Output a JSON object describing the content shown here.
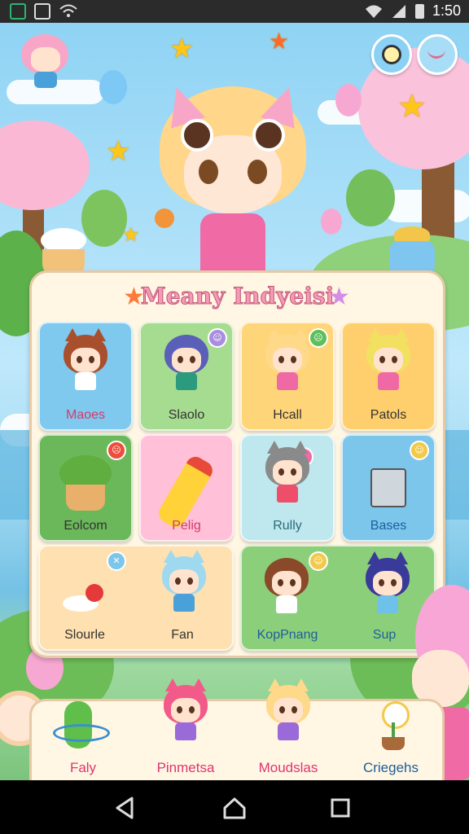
{
  "status_bar": {
    "time": "1:50"
  },
  "panel": {
    "title": "Meany Indyeisi",
    "cards": [
      {
        "label": "Maoes"
      },
      {
        "label": "Slaolo"
      },
      {
        "label": "Hcall"
      },
      {
        "label": "Patols"
      },
      {
        "label": "Eolcom"
      },
      {
        "label": "Pelig"
      },
      {
        "label": "Rully"
      },
      {
        "label": "Bases"
      },
      {
        "label": "Slourle",
        "label2": "Fan"
      },
      {
        "label": "KopPnang",
        "label2": "Sup"
      }
    ]
  },
  "dock": {
    "items": [
      {
        "label": "Faly"
      },
      {
        "label": "Pinmetsa"
      },
      {
        "label": "Moudslas"
      },
      {
        "label": "Criegehs"
      }
    ]
  },
  "colors": {
    "accent_pink": "#f59ab5",
    "card_blue": "#7fc8ee",
    "card_green": "#9fd98c",
    "card_orange": "#ffcf6e",
    "card_pink": "#ffc0d8",
    "card_teal": "#bfe7ee"
  }
}
